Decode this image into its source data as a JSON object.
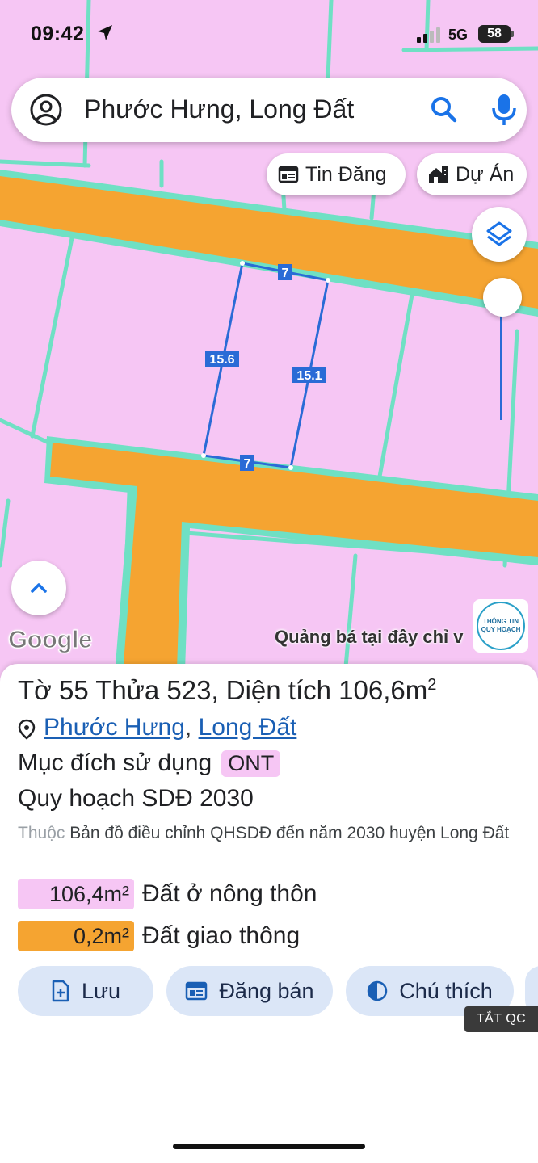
{
  "status_bar": {
    "time": "09:42",
    "network": "5G",
    "battery": "58"
  },
  "search": {
    "query": "Phước Hưng, Long Đất",
    "icons": [
      "account-icon",
      "search-icon",
      "mic-icon"
    ]
  },
  "chips": {
    "listings": "Tin Đăng",
    "projects": "Dự Án"
  },
  "map": {
    "colors": {
      "residential": "#f6c6f4",
      "road": "#f5a431",
      "boundary": "#6fe0c4",
      "parcel_outline": "#2a6bd6"
    },
    "parcel_edges": {
      "top": "7",
      "left": "15.6",
      "right": "15.1",
      "bottom": "7"
    },
    "google_logo": "Google",
    "ad_marquee": "Quảng bá tại đây chỉ v",
    "qh_badge": {
      "line1": "THÔNG TIN",
      "line2": "QUY HOẠCH"
    }
  },
  "parcel": {
    "title_prefix": "Tờ 55 Thửa 523, Diện tích ",
    "area": "106,6m",
    "area_sup": "2",
    "ward": "Phước Hưng",
    "district": "Long Đất",
    "purpose_label": "Mục đích sử dụng",
    "purpose_code": "ONT",
    "plan_label": "Quy hoạch SDĐ 2030",
    "belong_prefix": "Thuộc",
    "belong_text": "Bản đồ điều chỉnh QHSDĐ đến năm 2030 huyện Long Đất",
    "zones": [
      {
        "area": "106,4m²",
        "label": "Đất ở nông thôn",
        "color": "#f6c6f4"
      },
      {
        "area": "0,2m²",
        "label": "Đất giao thông",
        "color": "#f5a431"
      }
    ]
  },
  "actions": {
    "save": "Lưu",
    "post_sale": "Đăng bán",
    "legend": "Chú thích"
  },
  "ad_off": "TẮT QC"
}
